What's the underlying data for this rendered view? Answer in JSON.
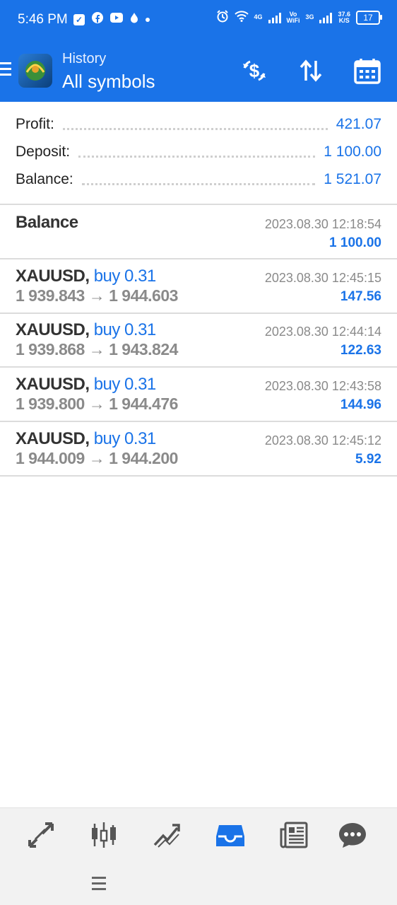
{
  "status_bar": {
    "time": "5:46 PM",
    "net_4g": "4G",
    "net_vowifi_top": "Vo",
    "net_vowifi_bottom": "WiFi",
    "net_3g": "3G",
    "speed_top": "37.6",
    "speed_bottom": "K/S",
    "battery": "17"
  },
  "header": {
    "title": "History",
    "subtitle": "All symbols",
    "actions": [
      "dollar-exchange-icon",
      "sort-icon",
      "calendar-icon"
    ]
  },
  "summary": {
    "profit_label": "Profit:",
    "profit_value": "421.07",
    "deposit_label": "Deposit:",
    "deposit_value": "1 100.00",
    "balance_label": "Balance:",
    "balance_value": "1 521.07"
  },
  "balance_entry": {
    "label": "Balance",
    "time": "2023.08.30 12:18:54",
    "amount": "1 100.00"
  },
  "deals": [
    {
      "symbol": "XAUUSD,",
      "type": "buy 0.31",
      "prices": "1 939.843 → 1 944.603",
      "time": "2023.08.30 12:45:15",
      "profit": "147.56"
    },
    {
      "symbol": "XAUUSD,",
      "type": "buy 0.31",
      "prices": "1 939.868 → 1 943.824",
      "time": "2023.08.30 12:44:14",
      "profit": "122.63"
    },
    {
      "symbol": "XAUUSD,",
      "type": "buy 0.31",
      "prices": "1 939.800 → 1 944.476",
      "time": "2023.08.30 12:43:58",
      "profit": "144.96"
    },
    {
      "symbol": "XAUUSD,",
      "type": "buy 0.31",
      "prices": "1 944.009 → 1 944.200",
      "time": "2023.08.30 12:45:12",
      "profit": "5.92"
    }
  ],
  "bottom_nav": {
    "items": [
      "quotes-icon",
      "chart-icon",
      "trade-icon",
      "history-icon",
      "news-icon",
      "chat-icon"
    ],
    "active": "history-icon",
    "active_color": "#1a73e8"
  },
  "colors": {
    "accent": "#1a73e8",
    "text_dark": "#333333",
    "text_muted": "#8a8a8a"
  }
}
